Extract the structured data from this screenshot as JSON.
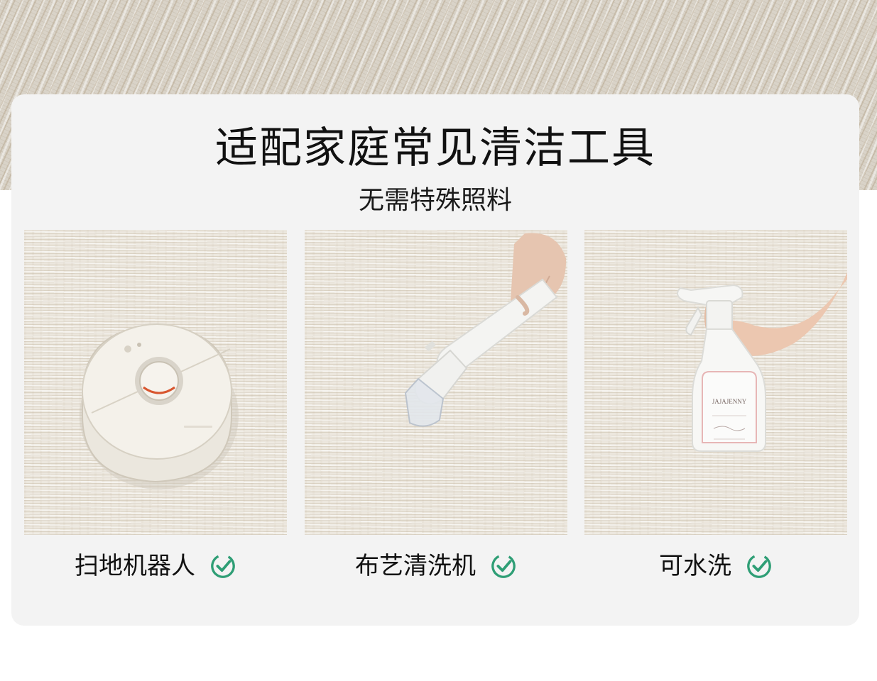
{
  "header": {
    "title": "适配家庭常见清洁工具",
    "subtitle": "无需特殊照料"
  },
  "tools": [
    {
      "label": "扫地机器人",
      "icon": "check-circle-icon",
      "photo": "robot-vacuum"
    },
    {
      "label": "布艺清洗机",
      "icon": "check-circle-icon",
      "photo": "fabric-cleaner"
    },
    {
      "label": "可水洗",
      "icon": "check-circle-icon",
      "photo": "spray-bottle"
    }
  ],
  "bottle": {
    "brand": "JAJAJENNY"
  },
  "colors": {
    "check_accent": "#2e9e75",
    "card_background": "#f3f3f3",
    "text": "#111111"
  }
}
